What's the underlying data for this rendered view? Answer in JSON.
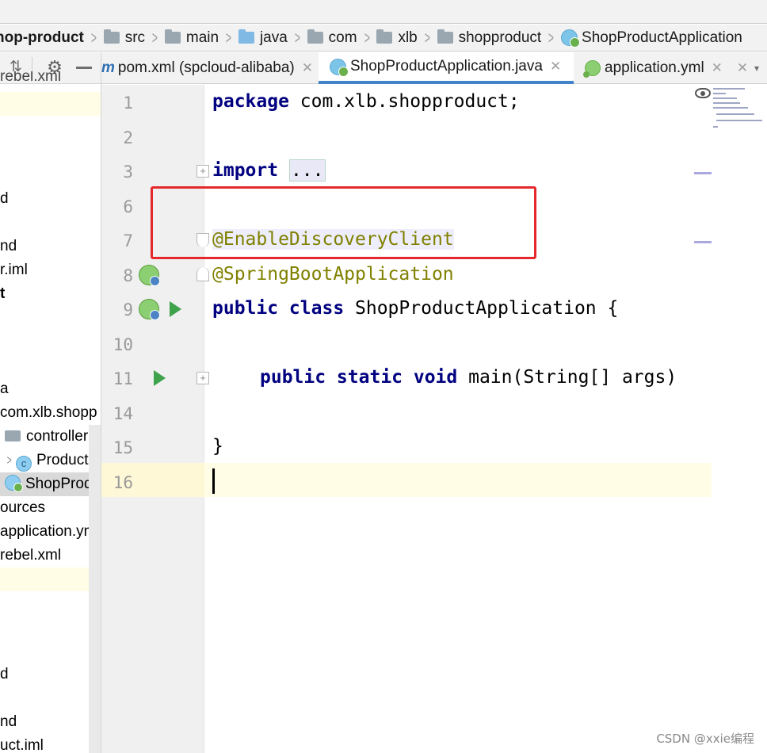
{
  "breadcrumb": {
    "project": "hop-product",
    "items": [
      "src",
      "main",
      "java",
      "com",
      "xlb",
      "shopproduct"
    ],
    "class_name": "ShopProductApplication"
  },
  "sidebar": {
    "toolbar": {
      "collapse_icon": "collapse-all-icon",
      "gear_icon": "gear-icon",
      "hide_icon": "minimize-icon"
    },
    "rows": [
      {
        "text": "rebel.xml"
      },
      {
        "text": ""
      },
      {
        "text": "d"
      },
      {
        "text": "nd"
      },
      {
        "text": "r.iml"
      },
      {
        "text": "t"
      },
      {
        "text": "a"
      },
      {
        "text": "com.xlb.shopp"
      },
      {
        "text": "controller"
      },
      {
        "text": "Product"
      },
      {
        "text": "ShopProdu"
      },
      {
        "text": "ources"
      },
      {
        "text": "application.ym"
      },
      {
        "text": "rebel.xml"
      },
      {
        "text": "d"
      },
      {
        "text": "nd"
      },
      {
        "text": "uct.iml"
      }
    ]
  },
  "tabs": [
    {
      "label": "pom.xml (spcloud-alibaba)"
    },
    {
      "label": "ShopProductApplication.java"
    },
    {
      "label": "application.yml"
    }
  ],
  "editor": {
    "line_numbers": [
      "1",
      "2",
      "3",
      "6",
      "7",
      "8",
      "9",
      "10",
      "11",
      "14",
      "15",
      "16"
    ],
    "code": {
      "l1_kw": "package",
      "l1_rest": " com.xlb.shopproduct;",
      "l3_kw": "import",
      "l3_dots": "...",
      "l7_ann": "@EnableDiscoveryClient",
      "l8_ann": "@SpringBootApplication",
      "l9_kw": "public class",
      "l9_rest": " ShopProductApplication {",
      "l11_kw": "public static void",
      "l11_rest": " main(String[] args)",
      "l15": "}"
    }
  },
  "watermark": "CSDN @xxie编程",
  "colors": {
    "keyword": "#000080",
    "annotation": "#808000",
    "highlight_box": "#e5282b",
    "active_tab_underline": "#4083c9"
  }
}
